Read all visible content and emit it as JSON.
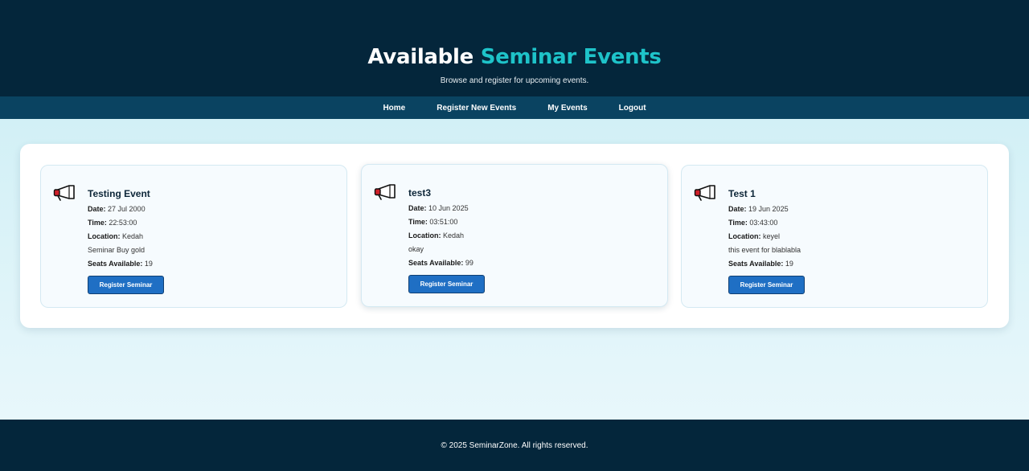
{
  "header": {
    "title_main": "Available",
    "title_accent": "Seminar Events",
    "subtitle": "Browse and register for upcoming events."
  },
  "nav": {
    "items": [
      {
        "label": "Home"
      },
      {
        "label": "Register New Events"
      },
      {
        "label": "My Events"
      },
      {
        "label": "Logout"
      }
    ]
  },
  "labels": {
    "date": "Date:",
    "time": "Time:",
    "location": "Location:",
    "seats": "Seats Available:"
  },
  "events": [
    {
      "icon": "megaphone-icon",
      "title": "Testing Event",
      "date": "27 Jul 2000",
      "time": "22:53:00",
      "location": "Kedah",
      "description": "Seminar Buy gold",
      "seats": "19",
      "button_label": "Register Seminar"
    },
    {
      "icon": "megaphone-icon",
      "title": "test3",
      "date": "10 Jun 2025",
      "time": "03:51:00",
      "location": "Kedah",
      "description": "okay",
      "seats": "99",
      "button_label": "Register Seminar"
    },
    {
      "icon": "megaphone-icon",
      "title": "Test 1",
      "date": "19 Jun 2025",
      "time": "03:43:00",
      "location": "keyel",
      "description": "this event for blablabla",
      "seats": "19",
      "button_label": "Register Seminar"
    }
  ],
  "footer": {
    "text": "© 2025 SeminarZone. All rights reserved."
  },
  "colors": {
    "header_bg": "#04263b",
    "nav_bg": "#0a4361",
    "accent": "#1ec3c9",
    "button": "#1f6fc4",
    "icon_red": "#d0202a"
  }
}
